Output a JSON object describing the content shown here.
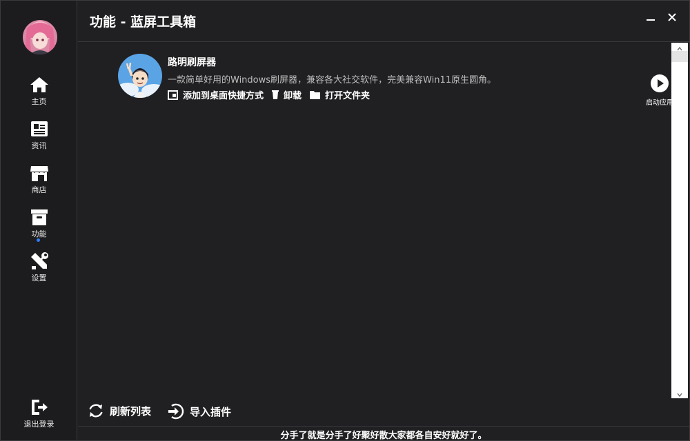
{
  "window": {
    "title": "功能 - 蓝屏工具箱"
  },
  "sidebar": {
    "items": [
      {
        "label": "主页",
        "icon": "home-icon"
      },
      {
        "label": "资讯",
        "icon": "news-icon"
      },
      {
        "label": "商店",
        "icon": "store-icon"
      },
      {
        "label": "功能",
        "icon": "archive-icon",
        "active": true
      },
      {
        "label": "设置",
        "icon": "tools-icon"
      }
    ],
    "logout_label": "退出登录"
  },
  "apps": [
    {
      "name": "路明刷屏器",
      "description": "一款简单好用的Windows刷屏器，兼容各大社交软件，完美兼容Win11原生圆角。",
      "actions": {
        "shortcut": "添加到桌面快捷方式",
        "uninstall": "卸载",
        "open_folder": "打开文件夹"
      },
      "launch_label": "启动应用"
    }
  ],
  "footer": {
    "refresh_label": "刷新列表",
    "import_label": "导入插件"
  },
  "status_text": "分手了就是分手了好聚好散大家都各自安好就好了。",
  "colors": {
    "background": "#202023",
    "sidebar": "#1c1c1f",
    "accent": "#2f7cf6",
    "border": "#3a3a3e"
  }
}
